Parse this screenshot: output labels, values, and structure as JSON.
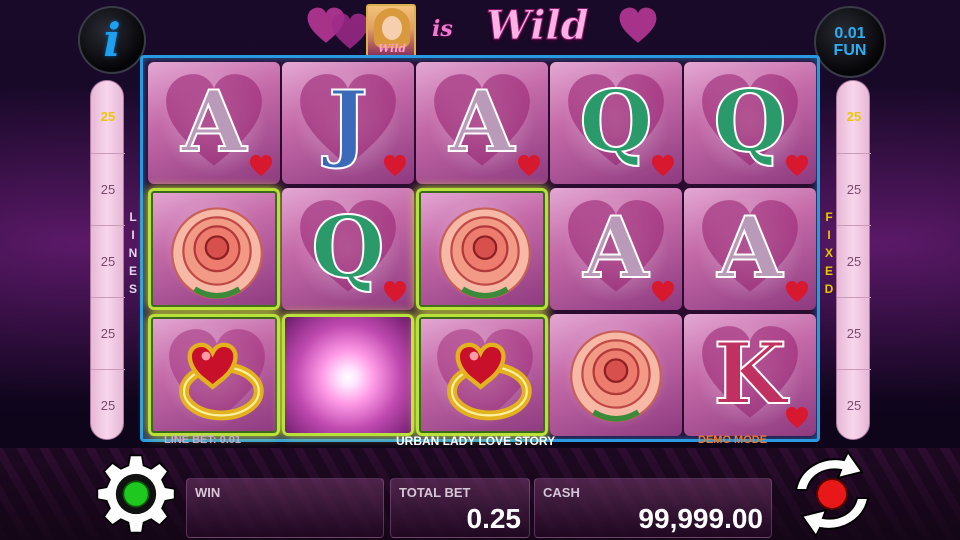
{
  "header": {
    "info_icon": "info-icon",
    "info_glyph": "i",
    "coin": {
      "value": "0.01",
      "unit": "FUN"
    },
    "title": {
      "is": "is",
      "wild": "Wild",
      "portrait_caption": "Wild"
    }
  },
  "lines_strip": {
    "word": [
      "L",
      "I",
      "N",
      "E",
      "S"
    ],
    "values": [
      "25",
      "25",
      "25",
      "25",
      "25"
    ]
  },
  "fixed_strip": {
    "word": [
      "F",
      "I",
      "X",
      "E",
      "D"
    ],
    "values": [
      "25",
      "25",
      "25",
      "25",
      "25"
    ]
  },
  "reels": [
    [
      "A",
      "rose",
      "ring"
    ],
    [
      "J",
      "Q",
      "flash"
    ],
    [
      "A",
      "rose",
      "ring"
    ],
    [
      "Q",
      "A",
      "rose"
    ],
    [
      "Q",
      "A",
      "K"
    ]
  ],
  "winning_positions": [
    [
      0,
      1
    ],
    [
      0,
      2
    ],
    [
      1,
      2
    ],
    [
      2,
      1
    ],
    [
      2,
      2
    ]
  ],
  "status": {
    "line_bet": "LINE BET: 0.01",
    "game_name": "URBAN LADY LOVE STORY",
    "demo_mode": "DEMO MODE"
  },
  "panel": {
    "win_label": "WIN",
    "win_value": "",
    "total_bet_label": "TOTAL BET",
    "total_bet_value": "0.25",
    "cash_label": "CASH",
    "cash_value": "99,999.00"
  },
  "icons": {
    "settings": "gear-icon",
    "autoplay_status": "green-light-icon",
    "spin": "spin-arrows-icon"
  },
  "colors": {
    "accent_blue": "#2ab0f5",
    "win_frame": "#b8e23a",
    "demo": "#f07a2a",
    "highlight_yellow": "#e8c800"
  }
}
